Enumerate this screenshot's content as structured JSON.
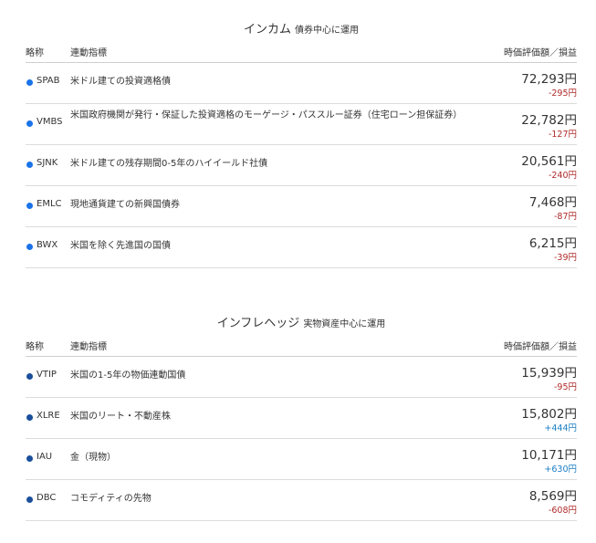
{
  "colors": {
    "dot_income": "#1a73e8",
    "dot_inflation": "#1b4f9c",
    "negative": "#b02a2a",
    "positive": "#1a7ec4"
  },
  "columns": {
    "ticker": "略称",
    "index": "連動指標",
    "value": "時価評価額／損益"
  },
  "sections": [
    {
      "title": "インカム",
      "subtitle": "債券中心に運用",
      "dot_color": "#1a73e8",
      "rows": [
        {
          "ticker": "SPAB",
          "name": "米ドル建ての投資適格債",
          "value": "72,293円",
          "pl": "-295円",
          "sign": "neg"
        },
        {
          "ticker": "VMBS",
          "name": "米国政府機関が発行・保証した投資適格のモーゲージ・パススルー証券（住宅ローン担保証券）",
          "value": "22,782円",
          "pl": "-127円",
          "sign": "neg"
        },
        {
          "ticker": "SJNK",
          "name": "米ドル建ての残存期間0-5年のハイイールド社債",
          "value": "20,561円",
          "pl": "-240円",
          "sign": "neg"
        },
        {
          "ticker": "EMLC",
          "name": "現地通貨建ての新興国債券",
          "value": "7,468円",
          "pl": "-87円",
          "sign": "neg"
        },
        {
          "ticker": "BWX",
          "name": "米国を除く先進国の国債",
          "value": "6,215円",
          "pl": "-39円",
          "sign": "neg"
        }
      ]
    },
    {
      "title": "インフレヘッジ",
      "subtitle": "実物資産中心に運用",
      "dot_color": "#1b4f9c",
      "rows": [
        {
          "ticker": "VTIP",
          "name": "米国の1-5年の物価連動国債",
          "value": "15,939円",
          "pl": "-95円",
          "sign": "neg"
        },
        {
          "ticker": "XLRE",
          "name": "米国のリート・不動産株",
          "value": "15,802円",
          "pl": "+444円",
          "sign": "pos"
        },
        {
          "ticker": "IAU",
          "name": "金（現物）",
          "value": "10,171円",
          "pl": "+630円",
          "sign": "pos"
        },
        {
          "ticker": "DBC",
          "name": "コモディティの先物",
          "value": "8,569円",
          "pl": "-608円",
          "sign": "neg"
        }
      ]
    }
  ]
}
